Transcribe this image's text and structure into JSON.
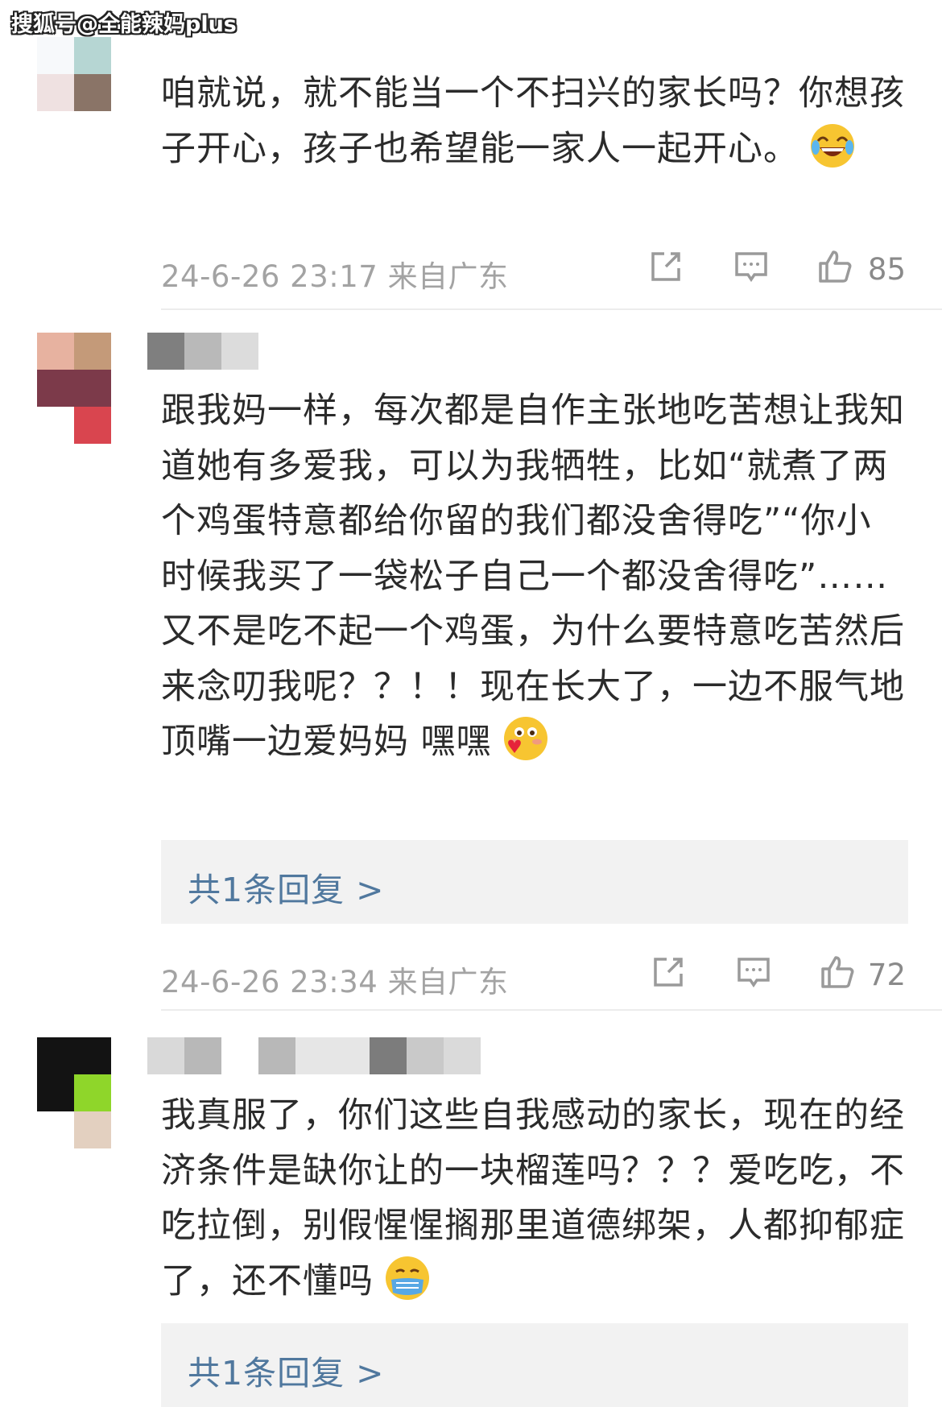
{
  "watermark": "搜狐号@全能辣妈plus",
  "comments": [
    {
      "text": "咱就说，就不能当一个不扫兴的家长吗？你想孩子开心，孩子也希望能一家人一起开心。",
      "emoji": "laughing-tears-emoji",
      "time": "24-6-26 23:17",
      "location": "来自广东",
      "likes": "85"
    },
    {
      "text": "跟我妈一样，每次都是自作主张地吃苦想让我知道她有多爱我，可以为我牺牲，比如“就煮了两个鸡蛋特意都给你留的我们都没舍得吃”“你小时候我买了一袋松子自己一个都没舍得吃”……又不是吃不起一个鸡蛋，为什么要特意吃苦然后来念叨我呢？？！！现在长大了，一边不服气地顶嘴一边爱妈妈 嘿嘿",
      "emoji": "blushing-heart-emoji",
      "reply": "共1条回复 >",
      "time": "24-6-26 23:34",
      "location": "来自广东",
      "likes": "72"
    },
    {
      "text": "我真服了，你们这些自我感动的家长，现在的经济条件是缺你让的一块榴莲吗？？？爱吃吃，不吃拉倒，别假惺惺搁那里道德绑架，人都抑郁症了，还不懂吗",
      "emoji": "masked-face-emoji",
      "reply": "共1条回复 >"
    }
  ],
  "colors": {
    "link": "#50789e",
    "meta": "#a3a3a3",
    "reply_bg": "#f2f2f2"
  }
}
